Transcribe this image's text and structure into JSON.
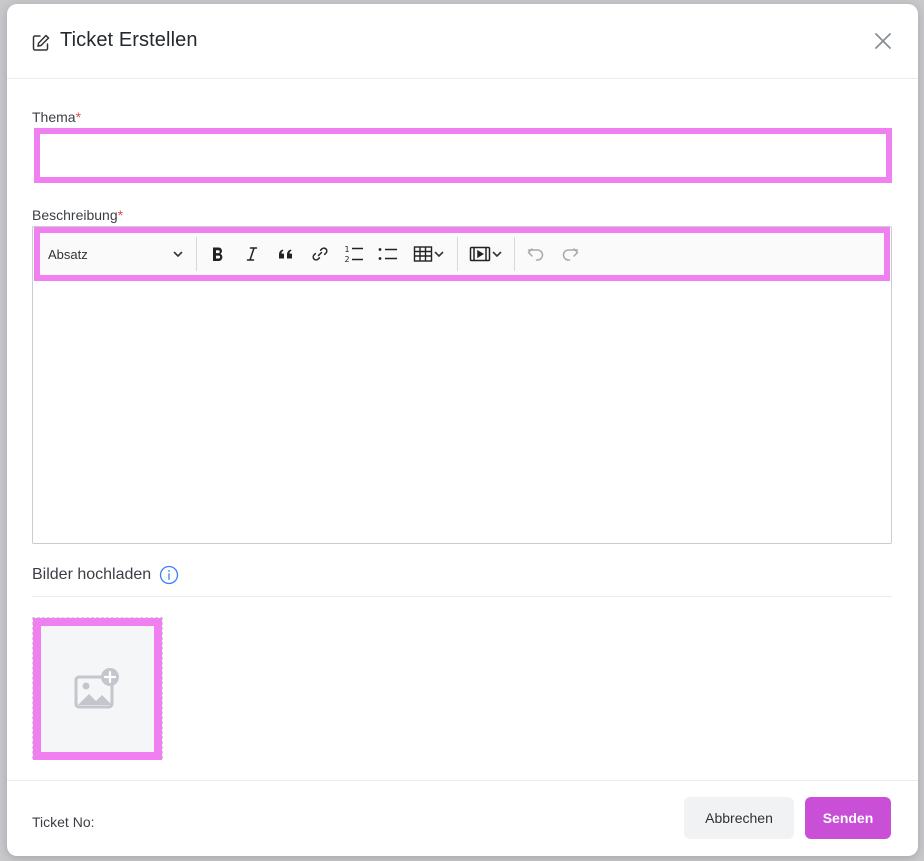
{
  "dialog": {
    "title": "Ticket Erstellen",
    "title_icon": "edit-icon",
    "close_icon": "close-icon"
  },
  "form": {
    "thema": {
      "label": "Thema",
      "required_mark": "*",
      "value": ""
    },
    "beschreibung": {
      "label": "Beschreibung",
      "required_mark": "*",
      "toolbar": {
        "block_format": "Absatz",
        "buttons": [
          "bold-icon",
          "italic-icon",
          "quote-icon",
          "link-icon",
          "numbered-list-icon",
          "bullet-list-icon",
          "table-icon",
          "media-icon",
          "undo-icon",
          "redo-icon"
        ]
      },
      "value": ""
    },
    "upload": {
      "label": "Bilder hochladen",
      "info_icon": "info-icon",
      "add_icon": "add-image-icon"
    }
  },
  "footer": {
    "ticket_no_label": "Ticket No:",
    "cancel_label": "Abbrechen",
    "send_label": "Senden"
  },
  "colors": {
    "highlight": "#f07ff0",
    "primary": "#c84fd6",
    "required": "#e5484d",
    "info": "#3b82f6"
  }
}
